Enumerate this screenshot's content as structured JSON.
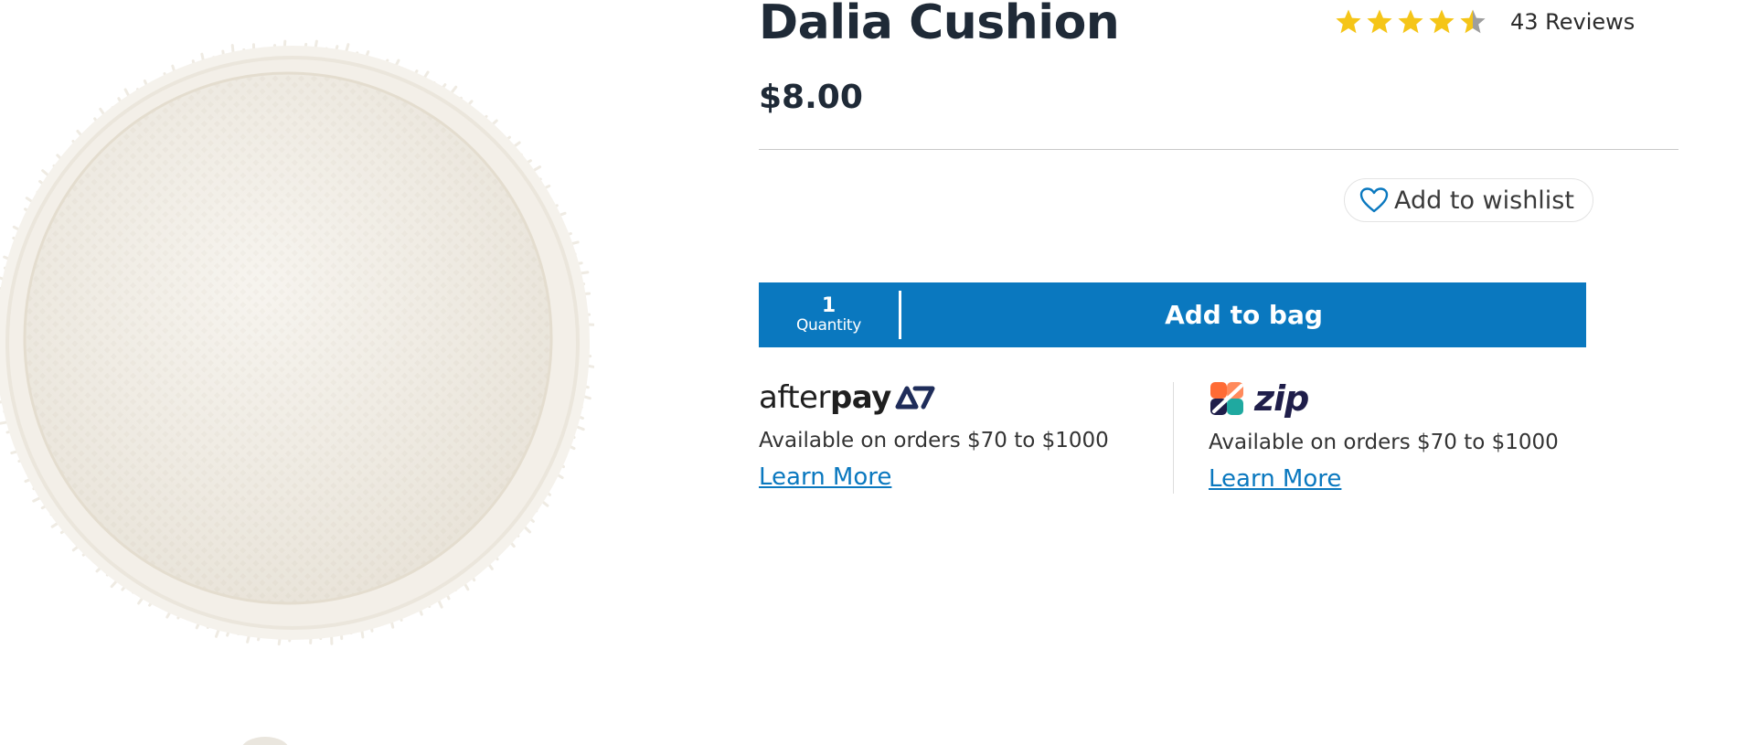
{
  "product": {
    "title": "Dalia Cushion",
    "price": "$8.00",
    "rating": 4.5,
    "rating_max": 5,
    "reviews_label": "43 Reviews"
  },
  "wishlist": {
    "label": "Add to wishlist",
    "icon": "heart-outline-icon"
  },
  "purchase": {
    "quantity_value": "1",
    "quantity_label": "Quantity",
    "add_to_bag_label": "Add to bag"
  },
  "payments": [
    {
      "provider": "afterpay",
      "logo_text_light": "after",
      "logo_text_bold": "pay",
      "description": "Available on orders $70 to $1000",
      "link_label": "Learn More"
    },
    {
      "provider": "zip",
      "logo_text": "zip",
      "description": "Available on orders $70 to $1000",
      "link_label": "Learn More"
    }
  ],
  "colors": {
    "primary": "#0a78bf",
    "title_text": "#1f2a37",
    "star": "#f5c518",
    "star_empty": "#9e9e9e",
    "afterpay_mark": "#1f2d5a",
    "zip_orange": "#ff6b35",
    "zip_teal": "#1fa9a0",
    "zip_navy": "#1f1e4a"
  }
}
